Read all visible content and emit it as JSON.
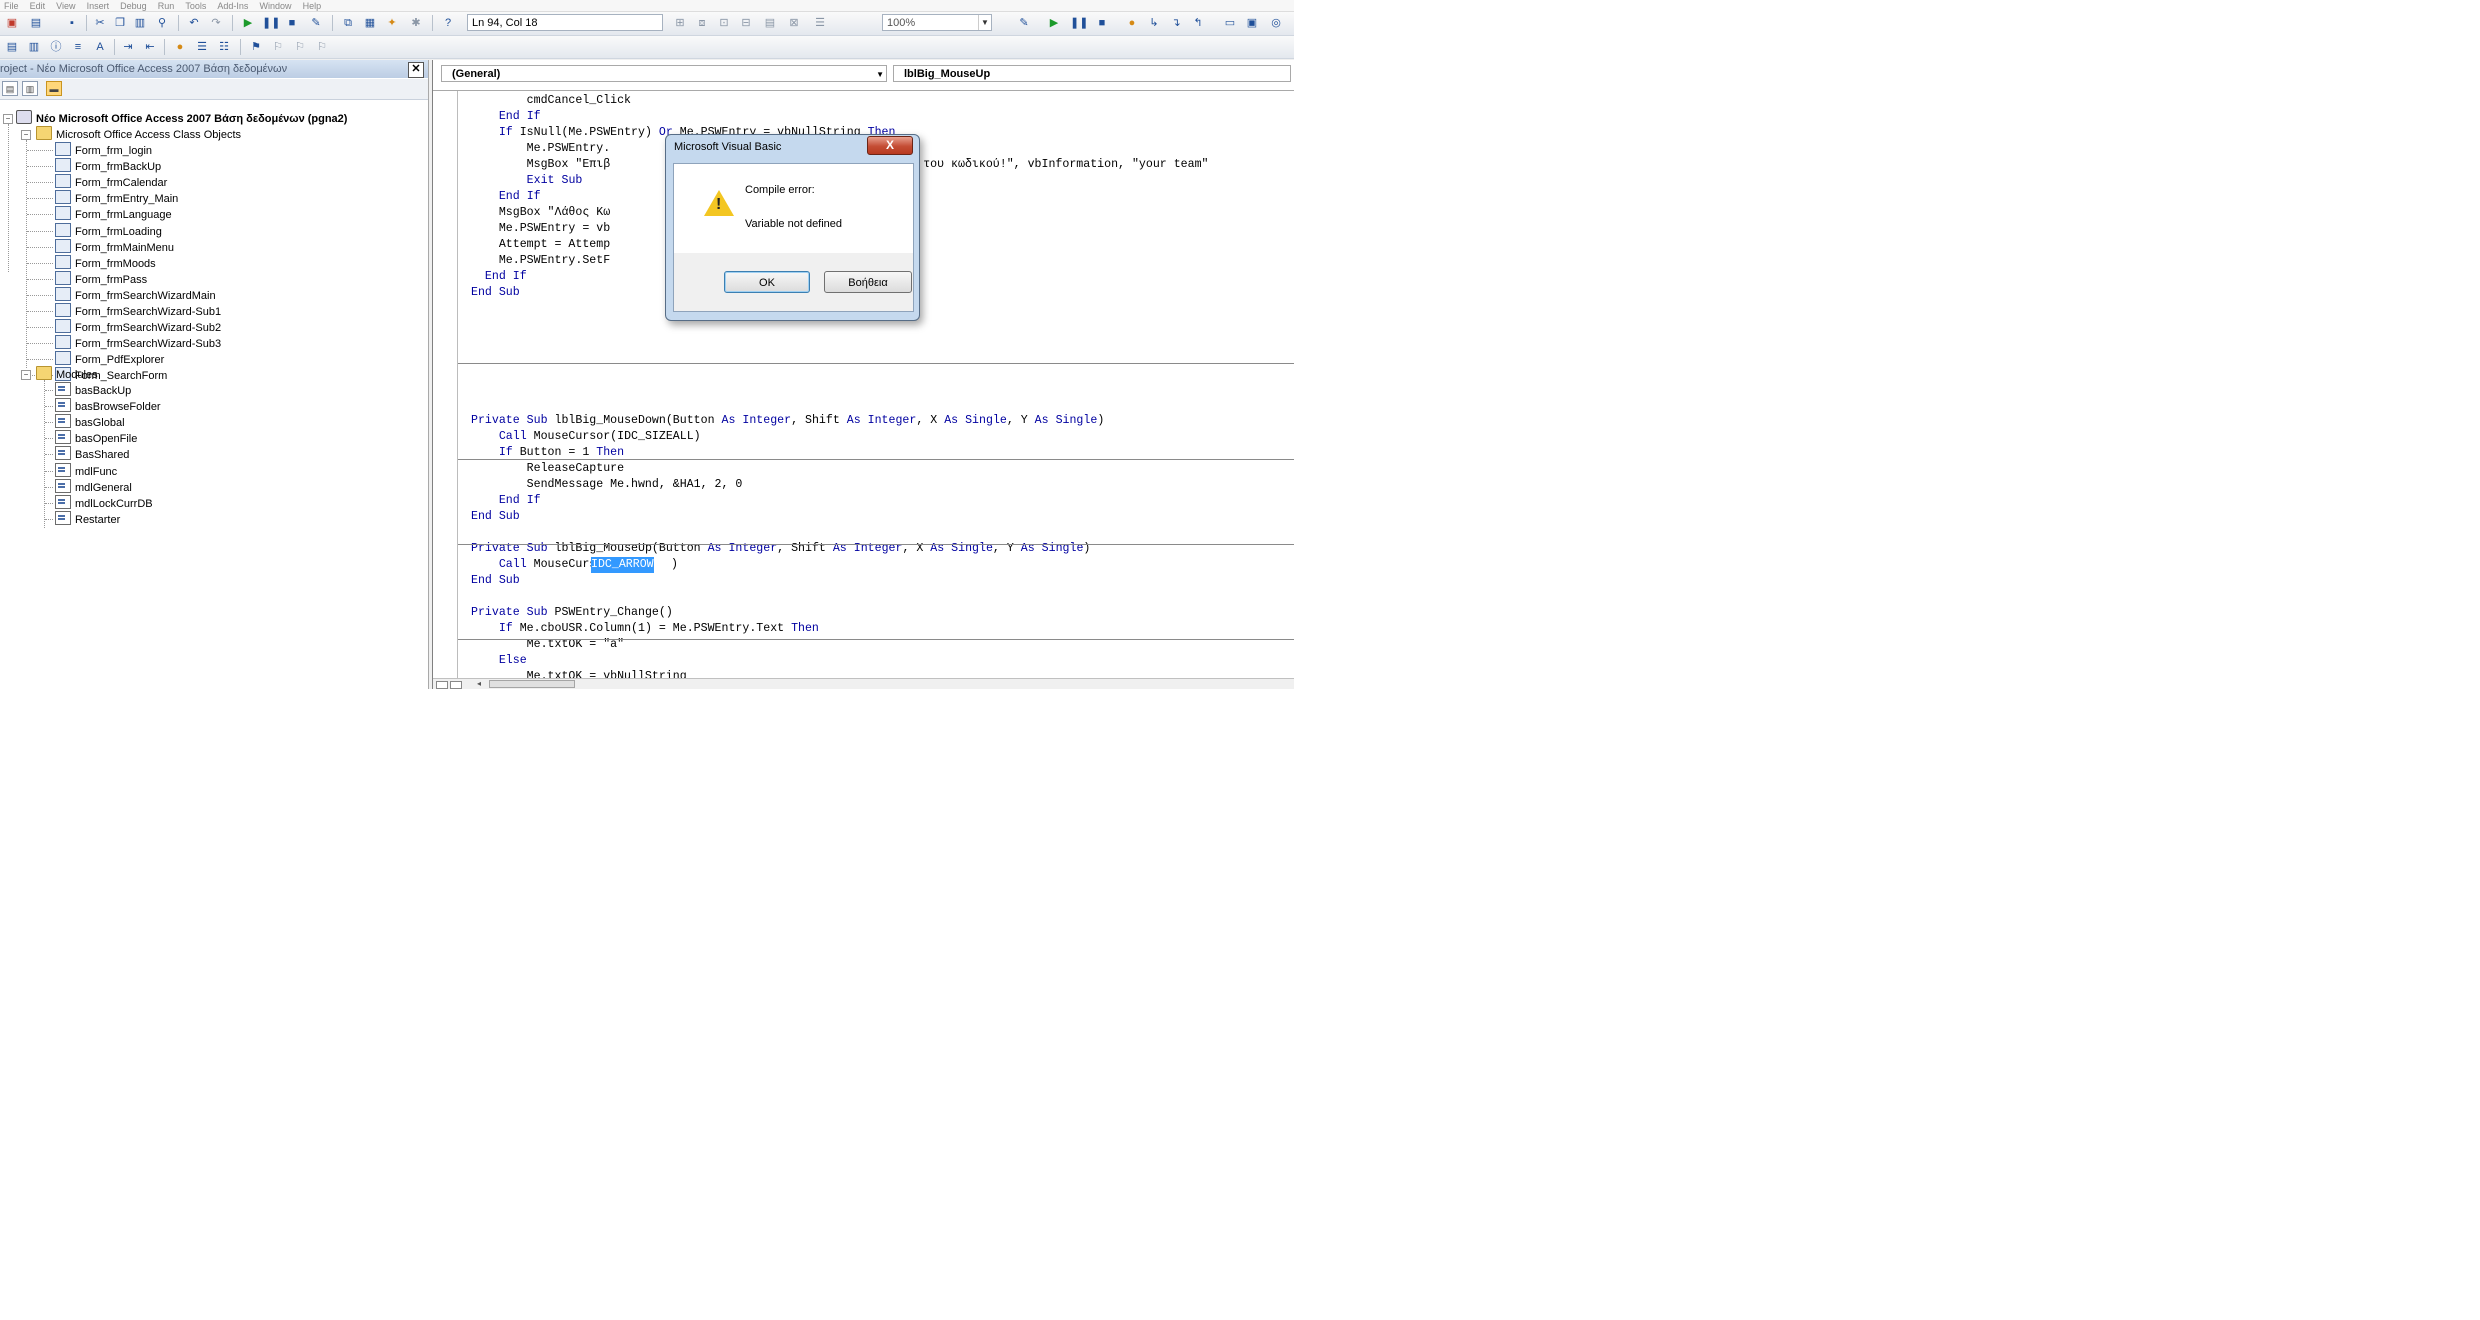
{
  "menu": {
    "items": [
      "File",
      "Edit",
      "View",
      "Insert",
      "Debug",
      "Run",
      "Tools",
      "Add-Ins",
      "Window",
      "Help"
    ]
  },
  "toolbar": {
    "position_text": "Ln 94, Col 18",
    "zoom_value": "100%"
  },
  "project": {
    "title": "roject - Νέο Microsoft Office Access 2007 Βάση δεδομένων",
    "root_label": "Νέο Microsoft Office Access 2007 Βάση δεδομένων (pgna2)",
    "class_objects_label": "Microsoft Office Access Class Objects",
    "forms": [
      "Form_frm_login",
      "Form_frmBackUp",
      "Form_frmCalendar",
      "Form_frmEntry_Main",
      "Form_frmLanguage",
      "Form_frmLoading",
      "Form_frmMainMenu",
      "Form_frmMoods",
      "Form_frmPass",
      "Form_frmSearchWizardMain",
      "Form_frmSearchWizard-Sub1",
      "Form_frmSearchWizard-Sub2",
      "Form_frmSearchWizard-Sub3",
      "Form_PdfExplorer",
      "Form_SearchForm"
    ],
    "modules_label": "Modules",
    "modules": [
      "basBackUp",
      "basBrowseFolder",
      "basGlobal",
      "basOpenFile",
      "BasShared",
      "mdlFunc",
      "mdlGeneral",
      "mdlLockCurrDB",
      "Restarter"
    ]
  },
  "code": {
    "object_combo": "(General)",
    "procedure_combo": "lblBig_MouseUp",
    "lines": [
      "        cmdCancel_Click",
      "    End If",
      "    If IsNull(Me.PSWEntry) Or Me.PSWEntry = vbNullString Then",
      "        Me.PSWEntry.",
      "        MsgBox \"Επιβ                                         και του κωδικού!\", vbInformation, \"your team\"",
      "        Exit Sub",
      "    End If",
      "    MsgBox \"Λάθος Κω                                   team\"",
      "    Me.PSWEntry = vb",
      "    Attempt = Attemp",
      "    Me.PSWEntry.SetF",
      "  End If",
      "End Sub",
      "Private Sub lblBig_MouseDown(Button As Integer, Shift As Integer, X As Single, Y As Single)",
      "    Call MouseCursor(IDC_SIZEALL)",
      "    If Button = 1 Then",
      "        ReleaseCapture",
      "        SendMessage Me.hwnd, &HA1, 2, 0",
      "    End If",
      "End Sub",
      "Private Sub lblBig_MouseUp(Button As Integer, Shift As Integer, X As Single, Y As Single)",
      "    Call MouseCursor(",
      "IDC_ARROW",
      ")",
      "End Sub",
      "Private Sub PSWEntry_Change()",
      "    If Me.cboUSR.Column(1) = Me.PSWEntry.Text Then",
      "        Me.txtOK = \"a\"",
      "    Else",
      "        Me.txtOK = vbNullString",
      "    End If"
    ]
  },
  "dialog": {
    "title": "Microsoft Visual Basic",
    "close_label": "X",
    "message_heading": "Compile error:",
    "message_detail": "Variable not defined",
    "ok_label": "OK",
    "help_label": "Βοήθεια"
  }
}
